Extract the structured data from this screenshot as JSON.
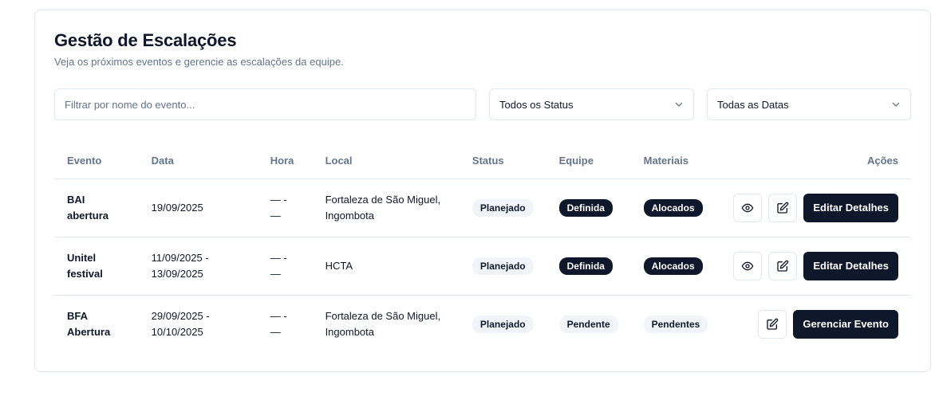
{
  "header": {
    "title": "Gestão de Escalações",
    "subtitle": "Veja os próximos eventos e gerencie as escalações da equipe."
  },
  "filters": {
    "search_placeholder": "Filtrar por nome do evento...",
    "status_value": "Todos os Status",
    "date_value": "Todas as Datas"
  },
  "table": {
    "headers": {
      "event": "Evento",
      "date": "Data",
      "time": "Hora",
      "location": "Local",
      "status": "Status",
      "team": "Equipe",
      "materials": "Materiais",
      "actions": "Ações"
    },
    "rows": [
      {
        "event": "BAI\nabertura",
        "date": "19/09/2025",
        "time": "— -\n—",
        "location": "Fortaleza de São Miguel,\nIngombota",
        "status": "Planejado",
        "team": "Definida",
        "materials": "Alocados",
        "action_label": "Editar Detalhes"
      },
      {
        "event": "Unitel\nfestival",
        "date": "11/09/2025 -\n13/09/2025",
        "time": "— -\n—",
        "location": "HCTA",
        "status": "Planejado",
        "team": "Definida",
        "materials": "Alocados",
        "action_label": "Editar Detalhes"
      },
      {
        "event": "BFA\nAbertura",
        "date": "29/09/2025 -\n10/10/2025",
        "time": "— -\n—",
        "location": "Fortaleza de São Miguel,\nIngombota",
        "status": "Planejado",
        "team": "Pendente",
        "materials": "Pendentes",
        "action_label": "Gerenciar Evento"
      }
    ]
  },
  "icons": {
    "view": "eye-icon",
    "edit": "edit-icon",
    "dropdown": "chevron-down-icon"
  },
  "colors": {
    "primary": "#0f172a",
    "muted": "#64748b",
    "border": "#e2e8f0",
    "badge_light": "#f1f5f9"
  }
}
